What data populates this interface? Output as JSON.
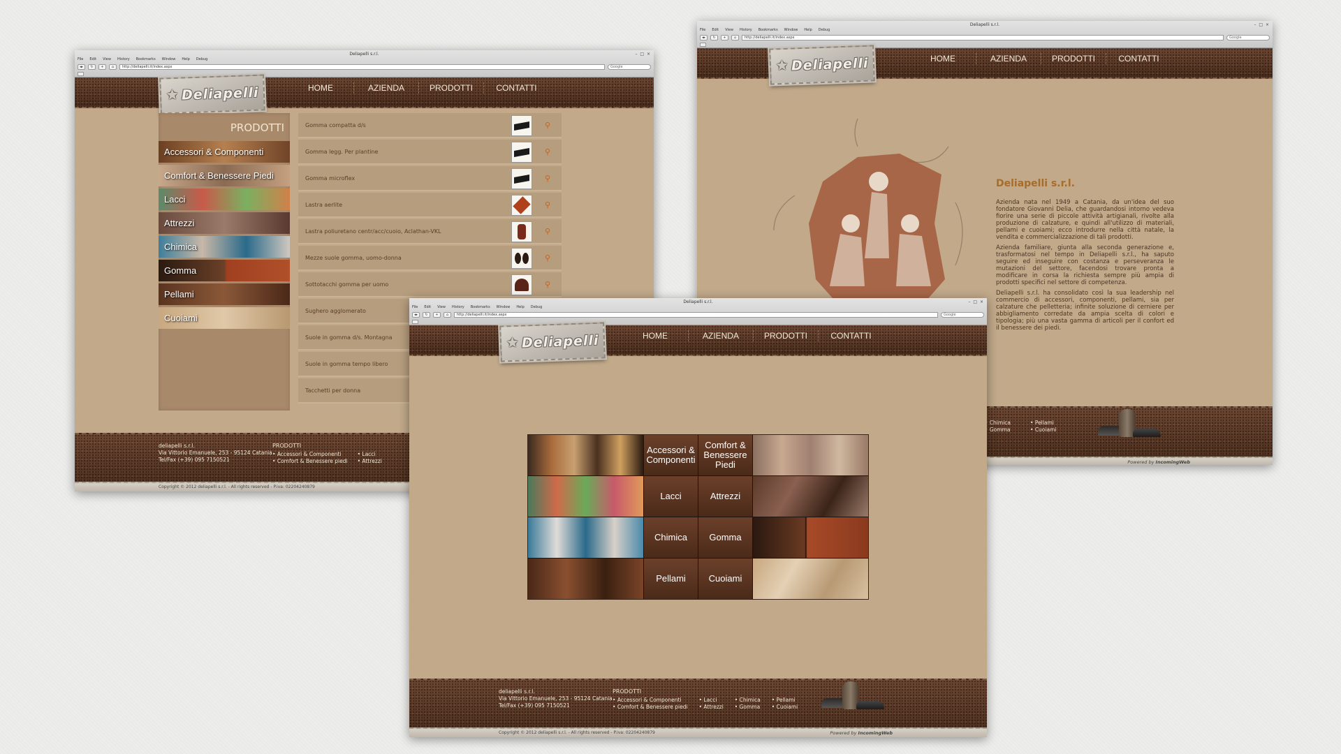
{
  "window_title": "Deliapelli s.r.l.",
  "menu": [
    "File",
    "Edit",
    "View",
    "History",
    "Bookmarks",
    "Window",
    "Help",
    "Debug"
  ],
  "url_main": "http://deliapelli.it/index.aspx",
  "url_az": "http://deliapelli.it/index.aspx",
  "search_placeholder": "Google",
  "logo_text": "Deliapelli",
  "nav": [
    "HOME",
    "AZIENDA",
    "PRODOTTI",
    "CONTATTI"
  ],
  "products": {
    "section_title": "PRODOTTI",
    "categories": [
      "Accessori & Componenti",
      "Comfort & Benessere Piedi",
      "Lacci",
      "Attrezzi",
      "Chimica",
      "Gomma",
      "Pellami",
      "Cuoiami"
    ],
    "items": [
      "Gomma compatta d/s",
      "Gomma legg. Per plantine",
      "Gomma microflex",
      "Lastra aerlite",
      "Lastra poliuretano centr/acc/cuoio, Aclathan-VKL",
      "Mezze suole gomma, uomo-donna",
      "Sottotacchi gomma per uomo",
      "Sughero agglomerato",
      "Suole in gomma d/s. Montagna",
      "Suole in gomma tempo libero",
      "Tacchetti per donna"
    ]
  },
  "grid": {
    "labels": [
      "Accessori & Componenti",
      "Comfort & Benessere Piedi",
      "Lacci",
      "Attrezzi",
      "Chimica",
      "Gomma",
      "Pellami",
      "Cuoiami"
    ]
  },
  "footer": {
    "company": "deliapelli s.r.l.",
    "address": "Via Vittorio Emanuele, 253 - 95124 Catania",
    "phone": "Tel/Fax (+39) 095 7150521",
    "products_title": "PRODOTTI",
    "col1": [
      "Accessori & Componenti",
      "Comfort & Benessere piedi"
    ],
    "col2": [
      "Lacci",
      "Attrezzi"
    ],
    "col3": [
      "Chimica",
      "Gomma"
    ],
    "col4": [
      "Pellami",
      "Cuoiami"
    ],
    "copyright": "Copyright © 2012 deliapelli s.r.l. - All rights reserved - P.iva: 02204240879",
    "powered": "Powered by",
    "powered_brand": "IncomingWeb"
  },
  "azienda": {
    "title": "Deliapelli s.r.l.",
    "p1": "Azienda nata nel 1949 a Catania, da un'idea del suo fondatore Giovanni Delia, che guardandosi intorno vedeva fiorire una serie di piccole attività artigianali, rivolte alla produzione di calzature, e quindi all'utilizzo di materiali, pellami e cuoiami; ecco introdurre nella città natale, la vendita e commercializzazione di tali prodotti.",
    "p2": "Azienda familiare, giunta alla seconda generazione e, trasformatosi nel tempo in Deliapelli s.r.l., ha saputo seguire ed inseguire con costanza e perseveranza le mutazioni del settore, facendosi trovare pronta a modificare in corsa la richiesta sempre più ampia di prodotti specifici nel settore di competenza.",
    "p3": "Deliapelli s.r.l. ha consolidato così la sua leadership nel commercio di accessori, componenti, pellami, sia per calzature che pelletteria; infinite soluzione di cerniere per abbigliamento corredate da ampia scelta di colori e tipologia; più una vasta gamma di articoli per il confort ed il benessere dei piedi."
  },
  "colors": {
    "accent": "#a86c2a",
    "leather": "#5e3a26",
    "page_bg": "#c1a98a"
  }
}
